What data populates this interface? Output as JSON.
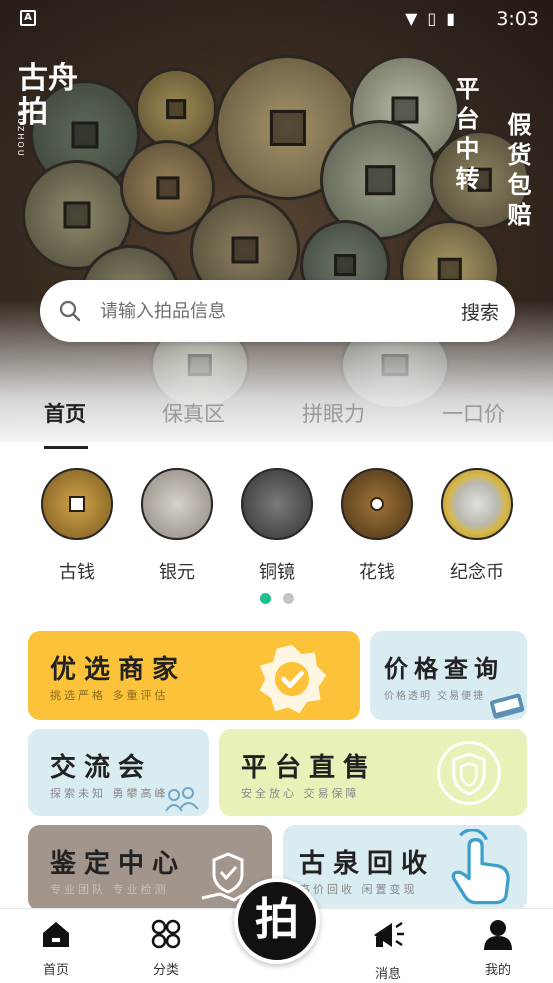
{
  "status_bar": {
    "time": "3:03"
  },
  "hero": {
    "logo_text": "古舟拍",
    "logo_small": "GUZHOU",
    "side_text_1": "平台中转",
    "side_text_2": "假货包赔"
  },
  "search": {
    "placeholder": "请输入拍品信息",
    "button_label": "搜索"
  },
  "tabs": [
    {
      "label": "首页",
      "active": true
    },
    {
      "label": "保真区",
      "active": false
    },
    {
      "label": "拼眼力",
      "active": false
    },
    {
      "label": "一口价",
      "active": false
    }
  ],
  "categories": [
    {
      "label": "古钱",
      "icon": "ancient-coin-icon",
      "color": "#b7892f"
    },
    {
      "label": "银元",
      "icon": "silver-dollar-icon",
      "color": "#b8b3ab"
    },
    {
      "label": "铜镜",
      "icon": "bronze-mirror-icon",
      "color": "#555555"
    },
    {
      "label": "花钱",
      "icon": "flower-coin-icon",
      "color": "#6b4a24"
    },
    {
      "label": "纪念币",
      "icon": "commemorative-coin-icon",
      "color": "#cfc7a8"
    }
  ],
  "carousel": {
    "pages": 2,
    "active": 0
  },
  "features": {
    "youxuan": {
      "title": "优选商家",
      "subtitle": "挑选严格 多重评估",
      "color": "#fcc33a"
    },
    "jiage": {
      "title": "价格查询",
      "subtitle": "价格透明 交易便捷",
      "color": "#d9ecf1"
    },
    "jiaoliu": {
      "title": "交流会",
      "subtitle": "探索未知 勇攀高峰",
      "color": "#d9ecf1"
    },
    "pingtai": {
      "title": "平台直售",
      "subtitle": "安全放心 交易保障",
      "color": "#e8f1b8"
    },
    "jianding": {
      "title": "鉴定中心",
      "subtitle": "专业团队 专业检测",
      "color": "#a2958c"
    },
    "huishou": {
      "title": "古泉回收",
      "subtitle": "高价回收 闲置变现",
      "color": "#d9ecf1"
    }
  },
  "bottom_nav": {
    "home": "首页",
    "category": "分类",
    "center": "拍",
    "message": "消息",
    "mine": "我的"
  }
}
